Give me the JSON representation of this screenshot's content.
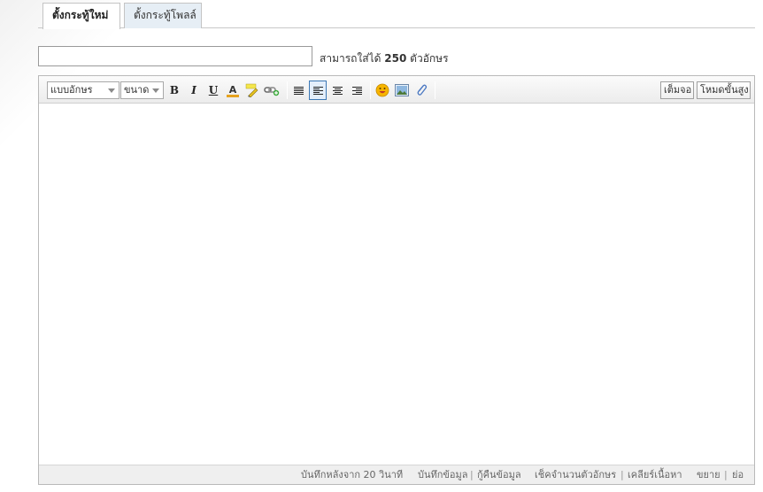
{
  "tabs": [
    {
      "label": "ตั้งกระทู้ใหม่",
      "active": true
    },
    {
      "label": "ตั้งกระทู้โพลล์",
      "active": false
    }
  ],
  "title_field": {
    "value": "",
    "hint_prefix": "สามารถใส่ได้",
    "hint_count": "250",
    "hint_suffix": "ตัวอักษร"
  },
  "toolbar": {
    "font_select": "แบบอักษร",
    "size_select": "ขนาด",
    "bold": "B",
    "italic": "I",
    "underline": "U",
    "text_color": "A",
    "fullscreen_label": "เต็มจอ",
    "advanced_mode_label": "โหมดขั้นสูง"
  },
  "statusbar": {
    "autosave": "บันทึกหลังจาก 20 วินาที",
    "save_data": "บันทึกข้อมูล",
    "restore_data": "กู้คืนข้อมูล",
    "check_length": "เช็คจำนวนตัวอักษร",
    "clear_content": "เคลียร์เนื้อหา",
    "expand": "ขยาย",
    "shrink": "ย่อ",
    "separator": "|"
  },
  "colors": {
    "active_tab_bg": "#ffffff",
    "inactive_tab_bg": "#e6eef5",
    "toolbar_bg": "#ececec",
    "selected_button_border": "#3c78b5",
    "statusbar_bg": "#efefef"
  }
}
